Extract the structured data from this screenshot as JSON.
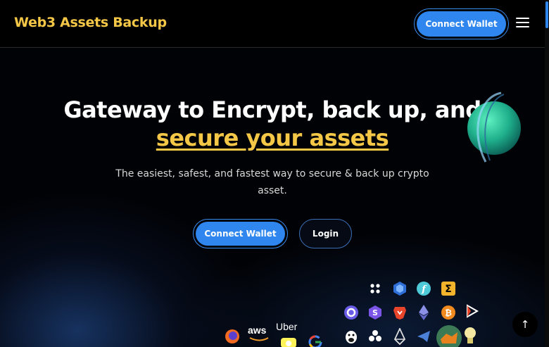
{
  "header": {
    "brand": "Web3 Assets Backup",
    "connect_label": "Connect Wallet",
    "menu_icon": "hamburger-menu-icon"
  },
  "hero": {
    "title_plain": "Gateway to Encrypt, back up, and ",
    "title_accent": "secure your assets",
    "subtitle": "The easiest, safest, and fastest way to secure & back up crypto asset.",
    "connect_label": "Connect Wallet",
    "login_label": "Login"
  },
  "logos": {
    "service_labels": [
      "aws",
      "Uber"
    ],
    "crypto_icons": [
      "polkadot-icon",
      "kyber-icon",
      "filecoin-icon",
      "elrond-icon",
      "ocean-icon",
      "solana-icon",
      "brave-icon",
      "ethereum-icon",
      "bitcoin-icon",
      "play-icon",
      "penguin-icon",
      "dots-icon",
      "eos-icon",
      "telegram-icon",
      "metamask-icon",
      "bulb-icon"
    ],
    "service_icons": [
      "firefox-icon",
      "aws-icon",
      "uber-icon",
      "google-icon",
      "snapchat-icon"
    ]
  },
  "colors": {
    "brand_accent": "#f5c746",
    "button_primary": "#2f86ee",
    "background": "#000000"
  },
  "scroll_top_icon": "arrow-up-icon"
}
